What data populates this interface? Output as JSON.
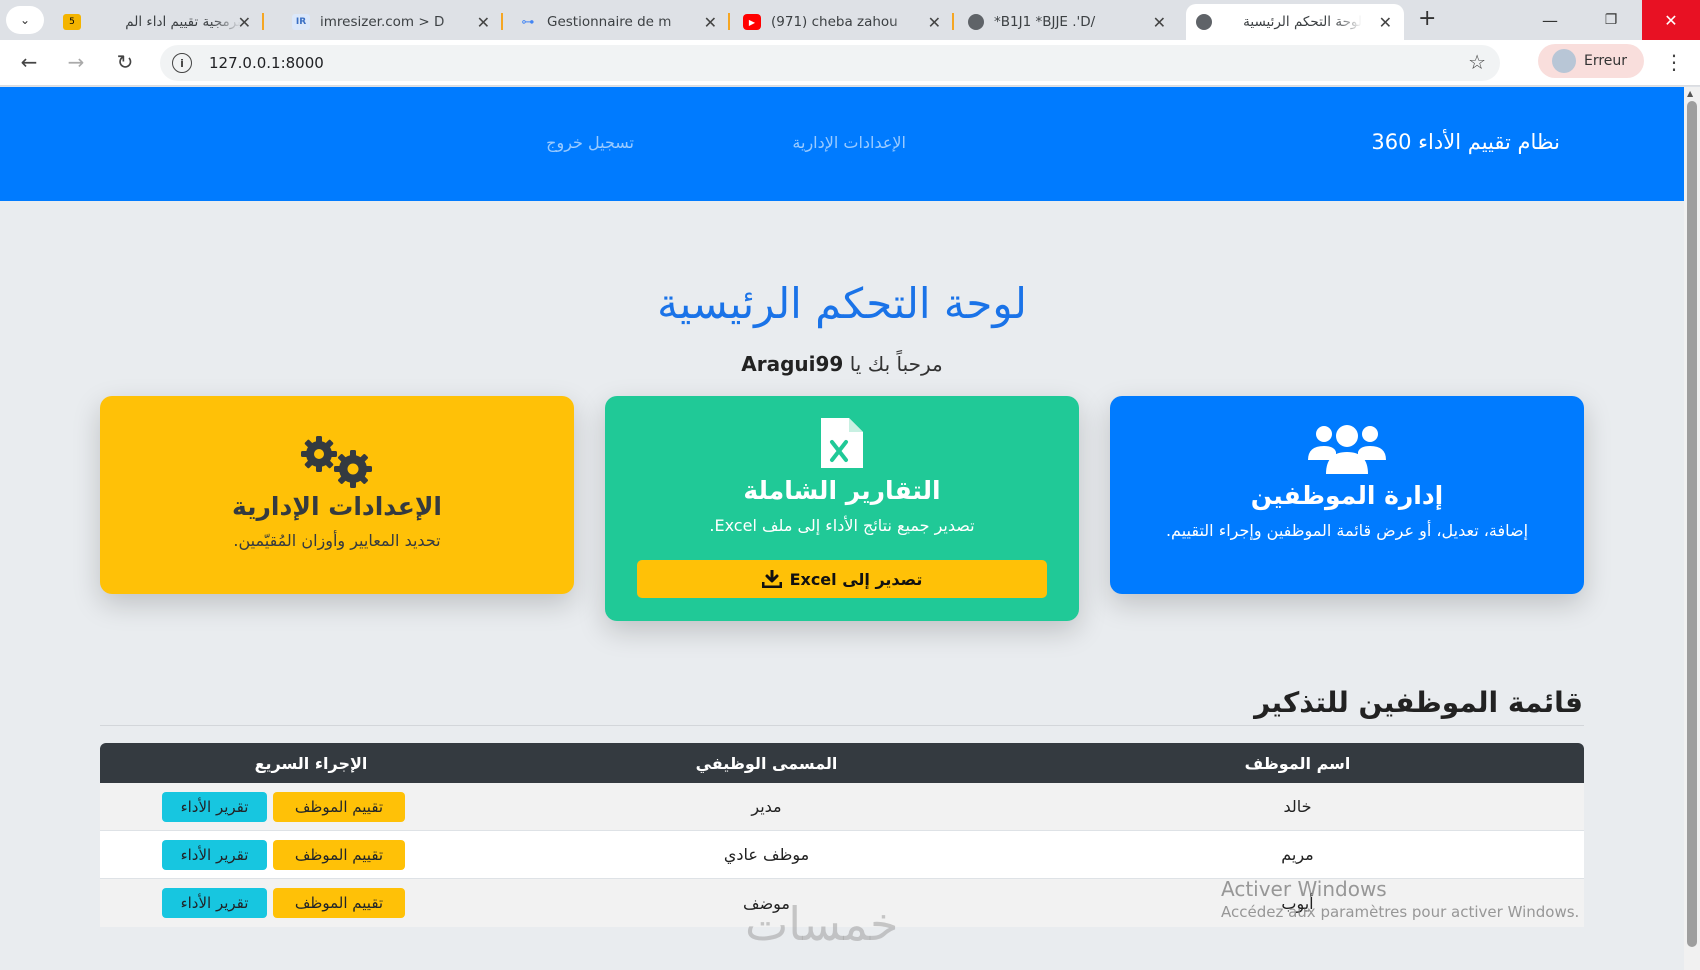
{
  "browser": {
    "tabs": [
      {
        "title": "برمجية تقييم اداء الم",
        "favicon": "5",
        "favicon_color": "#f4b400"
      },
      {
        "title": "imresizer.com > D",
        "favicon": "IR",
        "favicon_color": "#4a90e2"
      },
      {
        "title": "Gestionnaire de m",
        "favicon": "key-icon",
        "favicon_color": "#4285f4"
      },
      {
        "title": "(971) cheba zahou",
        "favicon": "youtube-icon",
        "favicon_color": "#ff0000"
      },
      {
        "title": "*B1J1 *BJJE .'D/",
        "favicon": "globe-icon",
        "favicon_color": "#555555"
      },
      {
        "title": "لوحة التحكم الرئيسية",
        "favicon": "globe-icon",
        "favicon_color": "#555555"
      }
    ],
    "url": "127.0.0.1:8000",
    "profile_label": "Erreur"
  },
  "navbar": {
    "brand": "نظام تقييم الأداء 360",
    "link_settings": "الإعدادات الإدارية",
    "link_logout": "تسجيل خروج"
  },
  "page": {
    "title": "لوحة التحكم الرئيسية",
    "welcome_prefix": "مرحباً بك يا",
    "username": "Aragui99"
  },
  "cards": {
    "employees": {
      "title": "إدارة الموظفين",
      "desc": "إضافة، تعديل، أو عرض قائمة الموظفين وإجراء التقييم.",
      "color": "#007bff",
      "icon": "users-icon"
    },
    "reports": {
      "title": "التقارير الشاملة",
      "desc": "تصدير جميع نتائج الأداء إلى ملف Excel.",
      "button": "تصدير إلى Excel",
      "color": "#20c997",
      "icon": "excel-file-icon"
    },
    "settings": {
      "title": "الإعدادات الإدارية",
      "desc": "تحديد المعايير وأوزان المُقيّمين.",
      "color": "#ffc107",
      "icon": "gears-icon"
    }
  },
  "employee_list": {
    "title": "قائمة الموظفين للتذكير",
    "headers": {
      "name": "اسم الموظف",
      "job": "المسمى الوظيفي",
      "action": "الإجراء السريع"
    },
    "evaluate_label": "تقييم الموظف",
    "report_label": "تقرير الأداء",
    "rows": [
      {
        "name": "خالد",
        "job": "مدير"
      },
      {
        "name": "مريم",
        "job": "موظف عادي"
      },
      {
        "name": "أيوب",
        "job": "موضف"
      }
    ]
  },
  "watermark": {
    "line1": "Activer Windows",
    "line2": "Accédez aux paramètres pour activer Windows.",
    "logo_text": "خمسات"
  }
}
